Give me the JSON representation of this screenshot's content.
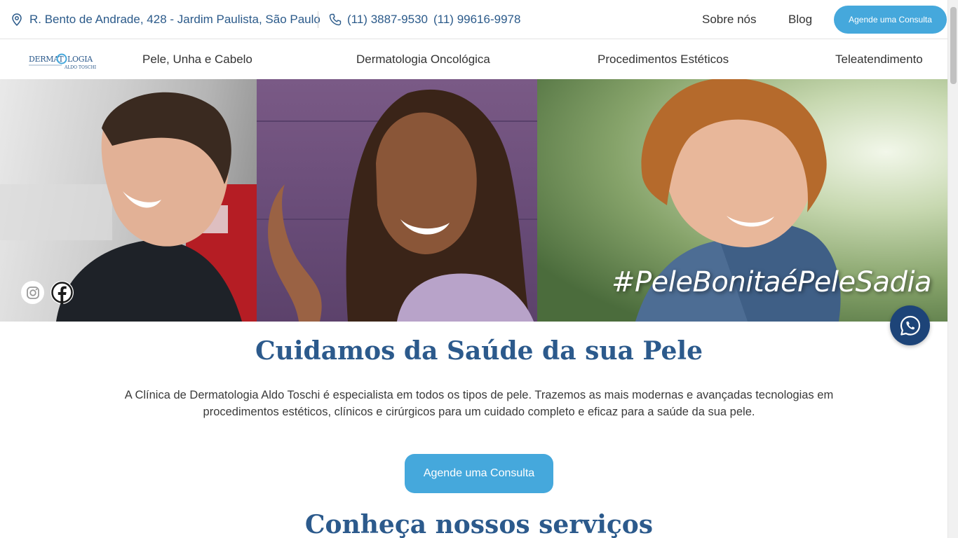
{
  "topbar": {
    "address": "R. Bento de Andrade, 428 - Jardim Paulista, São Paulo",
    "phone_1": "(11) 3887-9530",
    "phone_2": "(11) 99616-9978",
    "link_about": "Sobre nós",
    "link_blog": "Blog",
    "cta_label": "Agende uma Consulta"
  },
  "logo": {
    "text_top": "DERMATOLOGIA",
    "text_bottom": "ALDO TOSCHI"
  },
  "nav": {
    "items": [
      {
        "label": "Pele, Unha e Cabelo"
      },
      {
        "label": "Dermatologia Oncológica"
      },
      {
        "label": "Procedimentos Estéticos"
      },
      {
        "label": "Teleatendimento"
      }
    ]
  },
  "hero": {
    "hashtag": "#PeleBonitaéPeleSadia",
    "social": [
      "instagram-icon",
      "facebook-icon"
    ]
  },
  "main": {
    "title": "Cuidamos da Saúde da sua Pele",
    "lead_line_1": "A Clínica de Dermatologia Aldo Toschi é especialista em todos os tipos de pele. Trazemos as mais modernas e avançadas tecnologias em",
    "lead_line_2": "procedimentos estéticos, clínicos e cirúrgicos para um cuidado completo e eficaz para a saúde da sua pele.",
    "cta_label": "Agende uma Consulta",
    "services_title": "Conheça nossos serviços"
  },
  "colors": {
    "brand_blue": "#2c5a8c",
    "accent_blue": "#45a8dc",
    "whatsapp_bg": "#1d4478"
  }
}
